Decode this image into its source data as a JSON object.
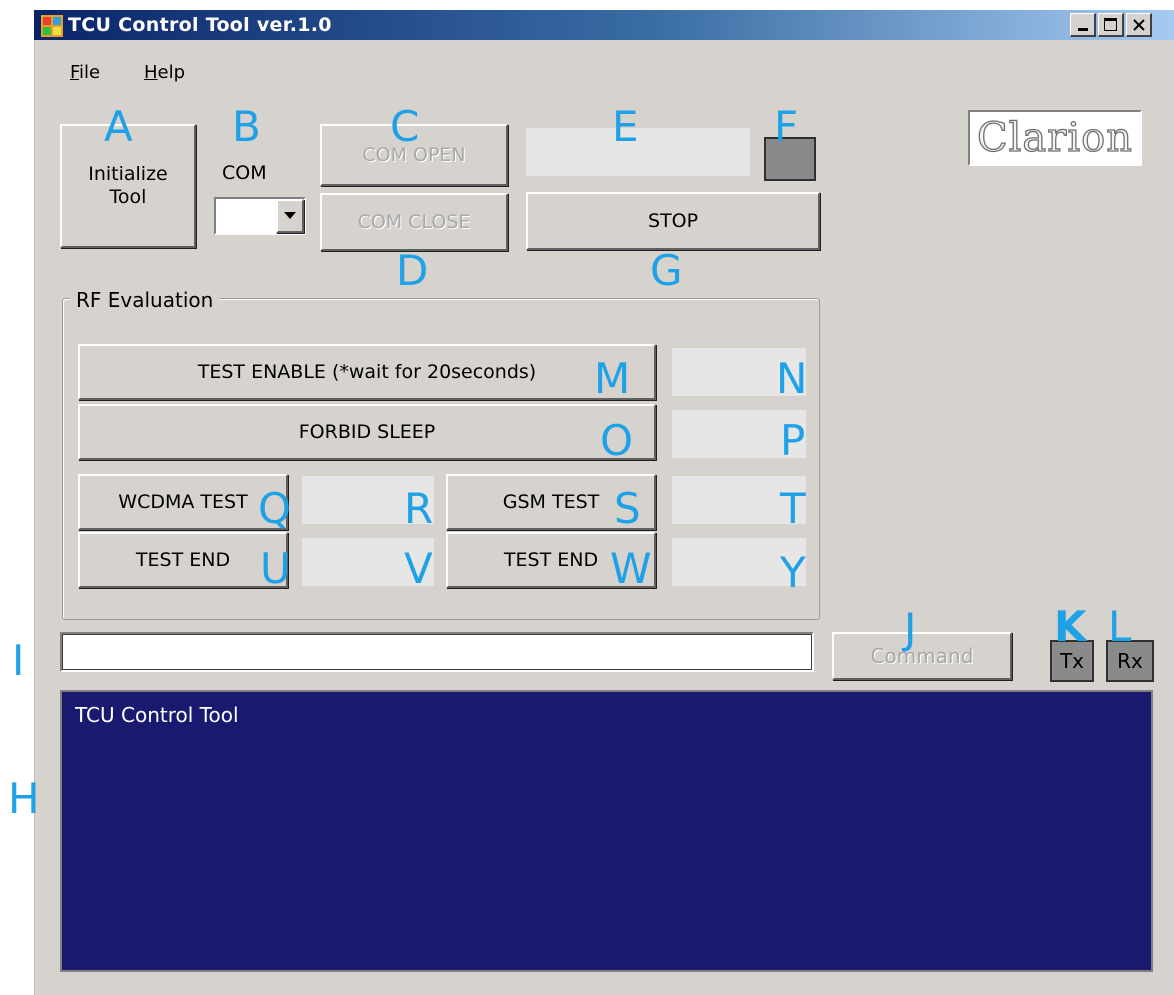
{
  "window": {
    "title": "TCU Control Tool ver.1.0"
  },
  "menu": {
    "file": "ile",
    "file_mnemonic": "F",
    "help": "elp",
    "help_mnemonic": "H"
  },
  "controls": {
    "initialize_line1": "Initialize",
    "initialize_line2": "Tool",
    "com_label": "COM",
    "com_value": "",
    "com_open": "COM OPEN",
    "com_close": "COM CLOSE",
    "status_field": "",
    "stop": "STOP"
  },
  "rf_evaluation": {
    "legend": "RF Evaluation",
    "test_enable": "TEST ENABLE (*wait for 20seconds)",
    "test_enable_status": "",
    "forbid_sleep": "FORBID SLEEP",
    "forbid_sleep_status": "",
    "wcdma_test": "WCDMA TEST",
    "wcdma_status": "",
    "wcdma_test_end": "TEST END",
    "wcdma_end_status": "",
    "gsm_test": "GSM TEST",
    "gsm_status": "",
    "gsm_test_end": "TEST END",
    "gsm_end_status": ""
  },
  "command": {
    "input_value": "",
    "button": "Command",
    "tx": "Tx",
    "rx": "Rx"
  },
  "console": {
    "text": "TCU Control Tool"
  },
  "logo": {
    "text": "Clarion"
  },
  "annotations": {
    "A": "A",
    "B": "B",
    "C": "C",
    "D": "D",
    "E": "E",
    "F": "F",
    "G": "G",
    "H": "H",
    "I": "I",
    "J": "J",
    "K": "K",
    "L": "L",
    "M": "M",
    "N": "N",
    "O": "O",
    "P": "P",
    "Q": "Q",
    "R": "R",
    "S": "S",
    "T": "T",
    "U": "U",
    "V": "V",
    "W": "W",
    "Y": "Y"
  },
  "colors": {
    "window_bg": "#d6d3ce",
    "console_bg": "#191970",
    "annotation": "#1ea1e6",
    "indicator": "#8a8a8a"
  }
}
